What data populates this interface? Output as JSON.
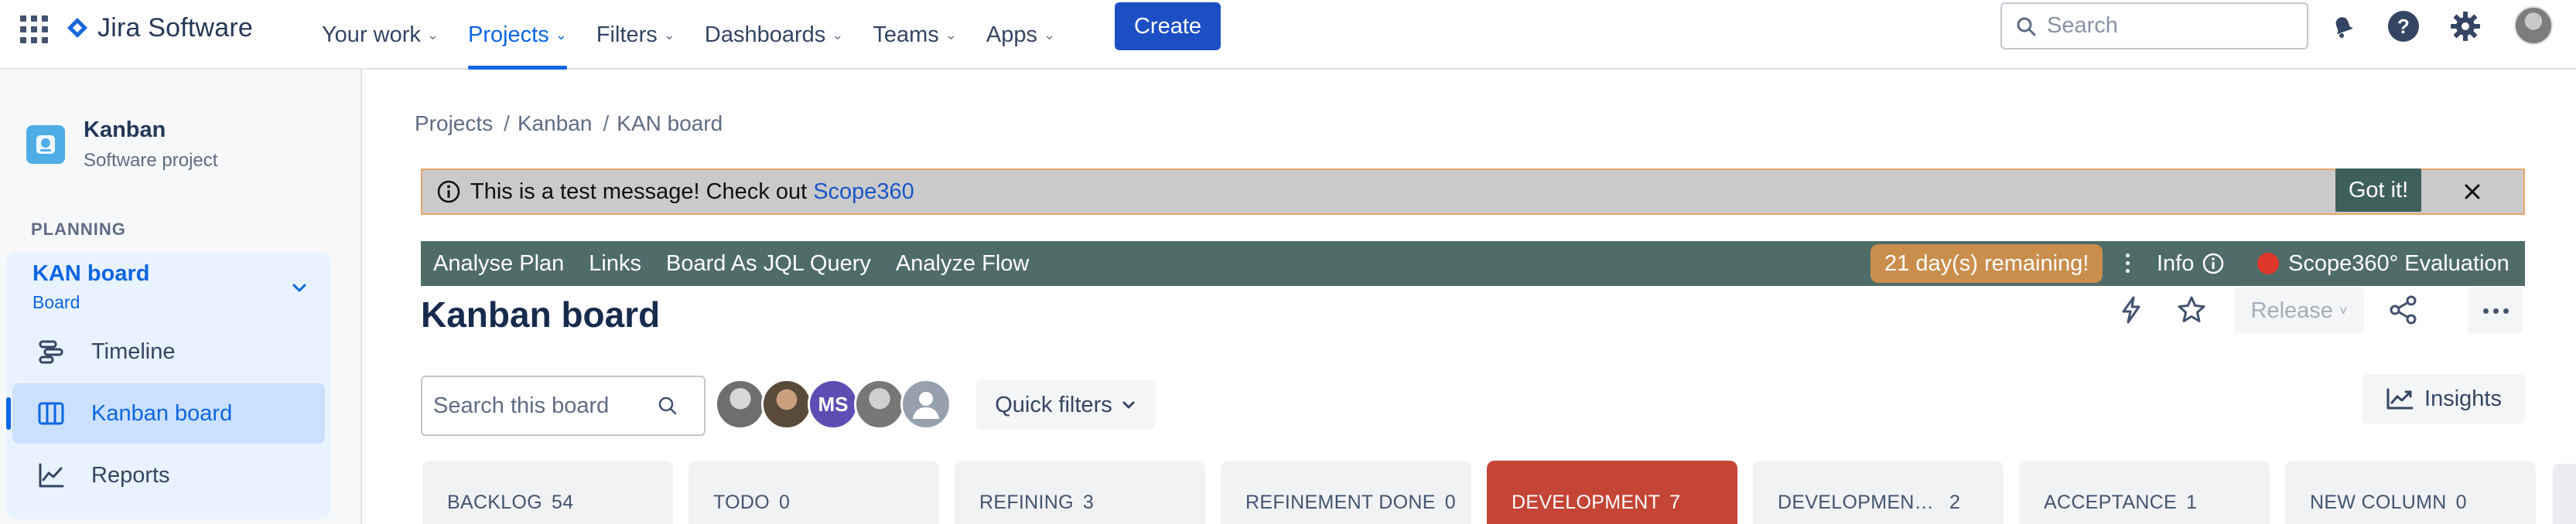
{
  "app": {
    "name": "Jira Software",
    "brand_color": "#0C66E4",
    "create_label": "Create"
  },
  "nav": {
    "items": [
      {
        "label": "Your work"
      },
      {
        "label": "Projects",
        "active": true
      },
      {
        "label": "Filters"
      },
      {
        "label": "Dashboards"
      },
      {
        "label": "Teams"
      },
      {
        "label": "Apps"
      }
    ],
    "search_placeholder": "Search",
    "icons": [
      "notifications-icon",
      "help-icon",
      "settings-icon",
      "avatar"
    ]
  },
  "sidebar": {
    "project_name": "Kanban",
    "project_type": "Software project",
    "section_label": "PLANNING",
    "board_group": {
      "title": "KAN board",
      "subtitle": "Board"
    },
    "items": [
      {
        "label": "Timeline",
        "icon": "timeline-icon"
      },
      {
        "label": "Kanban board",
        "icon": "board-icon",
        "active": true
      },
      {
        "label": "Reports",
        "icon": "reports-icon"
      }
    ]
  },
  "breadcrumb": [
    "Projects",
    "Kanban",
    "KAN board"
  ],
  "banner": {
    "message": "This is a test message! Check out",
    "link_text": "Scope360",
    "got_it_label": "Got it!",
    "background": "#CACACA",
    "border": "#E9A66B"
  },
  "scope_bar": {
    "items": [
      "Analyse Plan",
      "Links",
      "Board As JQL Query",
      "Analyze Flow"
    ],
    "remaining_label": "21 day(s) remaining!",
    "info_label": "Info",
    "evaluation_label": "Scope360° Evaluation",
    "background": "#4F6C69",
    "badge_color": "#C98E4C"
  },
  "board": {
    "title": "Kanban board",
    "release_label": "Release",
    "search_placeholder": "Search this board",
    "avatars": [
      "user-avatar",
      "user-avatar",
      "MS",
      "user-avatar",
      "unassigned-avatar"
    ],
    "quick_filters_label": "Quick filters",
    "insights_label": "Insights",
    "columns": [
      {
        "name": "BACKLOG",
        "count": "54"
      },
      {
        "name": "TODO",
        "count": "0"
      },
      {
        "name": "REFINING",
        "count": "3"
      },
      {
        "name": "REFINEMENT DONE",
        "count": "0"
      },
      {
        "name": "DEVELOPMENT",
        "count": "7",
        "highlight": "#C44536"
      },
      {
        "name": "DEVELOPMENT D...",
        "count": "2"
      },
      {
        "name": "ACCEPTANCE",
        "count": "1"
      },
      {
        "name": "NEW COLUMN",
        "count": "0"
      }
    ]
  }
}
